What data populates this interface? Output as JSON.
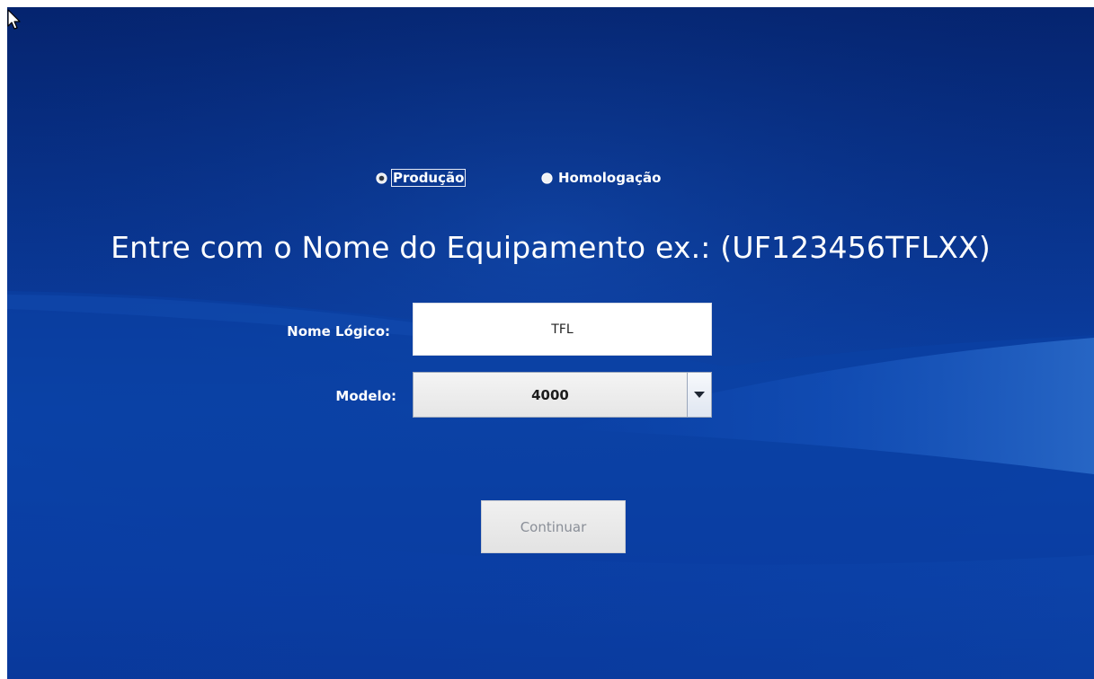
{
  "environment": {
    "options": [
      {
        "label": "Produção",
        "selected": true
      },
      {
        "label": "Homologação",
        "selected": false
      }
    ]
  },
  "form": {
    "headline": "Entre com o Nome do Equipamento ex.: (UF123456TFLXX)",
    "nome_logico": {
      "label": "Nome Lógico:",
      "value": "TFL"
    },
    "modelo": {
      "label": "Modelo:",
      "selected": "4000"
    },
    "continue_label": "Continuar"
  },
  "colors": {
    "background": "#0a3a9a",
    "text": "#ffffff",
    "disabled_text": "#8a8f98"
  },
  "icons": {
    "cursor": "mouse-pointer-icon",
    "dropdown": "chevron-down-icon",
    "radio_selected": "radio-selected-icon",
    "radio_unselected": "radio-unselected-icon"
  }
}
